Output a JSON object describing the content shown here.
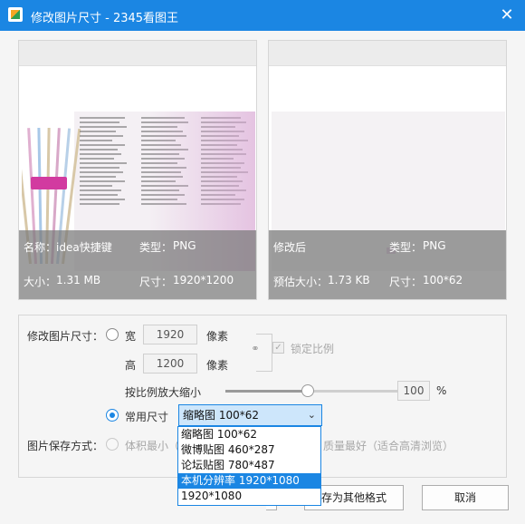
{
  "window": {
    "title": "修改图片尺寸 - 2345看图王"
  },
  "original": {
    "name_label": "名称：",
    "name_value": "idea快捷键",
    "type_label": "类型：",
    "type_value": "PNG",
    "size_label": "大小：",
    "size_value": "1.31 MB",
    "dim_label": "尺寸：",
    "dim_value": "1920*1200"
  },
  "modified": {
    "label": "修改后",
    "type_label": "类型：",
    "type_value": "PNG",
    "est_label": "预估大小：",
    "est_value": "1.73 KB",
    "dim_label": "尺寸：",
    "dim_value": "100*62"
  },
  "resize": {
    "section_label": "修改图片尺寸：",
    "width_label": "宽",
    "width_value": "1920",
    "width_unit": "像素",
    "height_label": "高",
    "height_value": "1200",
    "height_unit": "像素",
    "lock_label": "锁定比例",
    "scale_label": "按比例放大缩小",
    "scale_value": "100",
    "scale_unit": "%",
    "scale_level_fraction": 0.44,
    "preset_label": "常用尺寸",
    "preset_selected": "缩略图 100*62",
    "preset_options": [
      "缩略图 100*62",
      "微博贴图 460*287",
      "论坛贴图 780*487",
      "本机分辨率 1920*1080",
      "1920*1080"
    ],
    "preset_highlight_index": 3
  },
  "save": {
    "label": "图片保存方式：",
    "opt1": "体积最小（",
    "opt2": "质量最好（适合高清浏览）"
  },
  "buttons": {
    "save_other": "存为其他格式",
    "cancel": "取消"
  },
  "colors": {
    "accent": "#1b86e3",
    "highlight": "#cde6fb"
  }
}
